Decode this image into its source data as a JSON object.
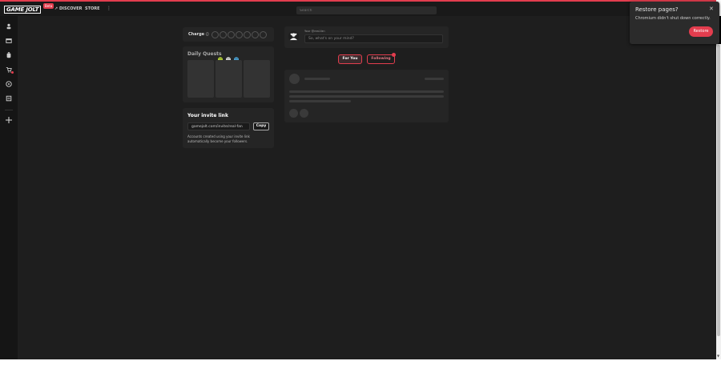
{
  "topbar": {
    "logo": "GAME JOLT",
    "beta": "Beta",
    "nav_discover": "DISCOVER",
    "nav_store": "STORE",
    "more": "⋮",
    "search_placeholder": "Search"
  },
  "charge": {
    "label": "Charge",
    "filled": 0,
    "total": 7
  },
  "quests": {
    "title": "Daily Quests"
  },
  "invite": {
    "title": "Your invite link",
    "url": "gamejolt.com/invite/real-fan",
    "copy_label": "Copy",
    "description": "Accounts created using your invite link automatically become your followers."
  },
  "post": {
    "label": "Your @real-fan",
    "placeholder": "So, what's on your mind?"
  },
  "feed": {
    "tab_for_you": "For You",
    "tab_following": "Following"
  },
  "restore_popup": {
    "title": "Restore pages?",
    "message": "Chromium didn't shut down correctly.",
    "button": "Restore",
    "close": "✕"
  },
  "colors": {
    "accent": "#e33d4e",
    "background": "#1e1e1e",
    "panel": "#252525"
  }
}
